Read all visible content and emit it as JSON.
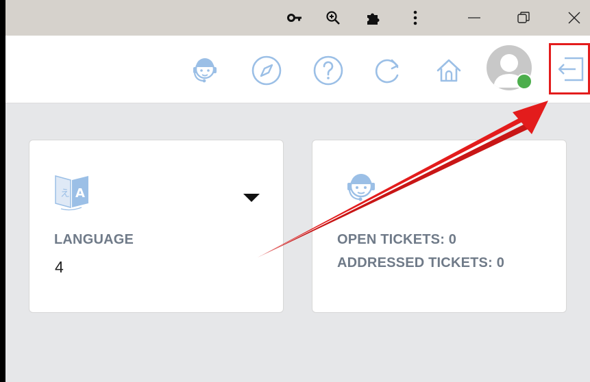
{
  "chrome": {
    "icons": [
      "key-icon",
      "zoom-in-icon",
      "puzzle-icon",
      "more-vert-icon",
      "minimize-icon",
      "restore-icon",
      "close-icon"
    ]
  },
  "header": {
    "icons": [
      "support-agent-icon",
      "compass-icon",
      "help-icon",
      "refresh-icon",
      "home-icon",
      "avatar",
      "logout-icon"
    ],
    "accent": "#9bbfe6",
    "status_color": "#4cae4c",
    "highlight_color": "#e31c1c"
  },
  "language_card": {
    "label": "LANGUAGE",
    "value": "4"
  },
  "tickets_card": {
    "open_label": "OPEN TICKETS: 0",
    "addressed_label": "ADDRESSED TICKETS: 0"
  },
  "colors": {
    "page_bg": "#e6e7e9",
    "chrome_bg": "#d6d2cc",
    "label": "#6f7a88",
    "annotation_arrow": "#e31c1c"
  }
}
